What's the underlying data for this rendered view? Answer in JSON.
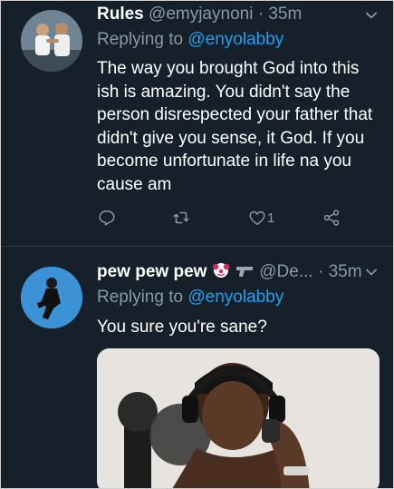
{
  "tweets": [
    {
      "name": "Rules",
      "handle": "@emyjaynoni",
      "separator": " · ",
      "time": "35m",
      "replying_prefix": "Replying to ",
      "replying_to": "@enyolabby",
      "text": "The way you brought God into this ish is amazing. You didn't say the person disrespected your father that didn't give you sense, it God. If you become unfortunate in life na you cause am",
      "reply_count": "",
      "retweet_count": "",
      "like_count": "1"
    },
    {
      "name": "pew pew pew",
      "handle": "@De...",
      "separator": " · ",
      "time": "35m",
      "replying_prefix": "Replying to ",
      "replying_to": "@enyolabby",
      "text": "You sure you're sane?"
    }
  ],
  "colors": {
    "background": "#15202b",
    "text": "#ffffff",
    "muted": "#8899a6",
    "accent": "#1da1f2"
  },
  "icons": [
    "reply-icon",
    "retweet-icon",
    "like-icon",
    "share-icon",
    "chevron-down-icon",
    "clown-emoji-icon",
    "gun-emoji-icon"
  ]
}
